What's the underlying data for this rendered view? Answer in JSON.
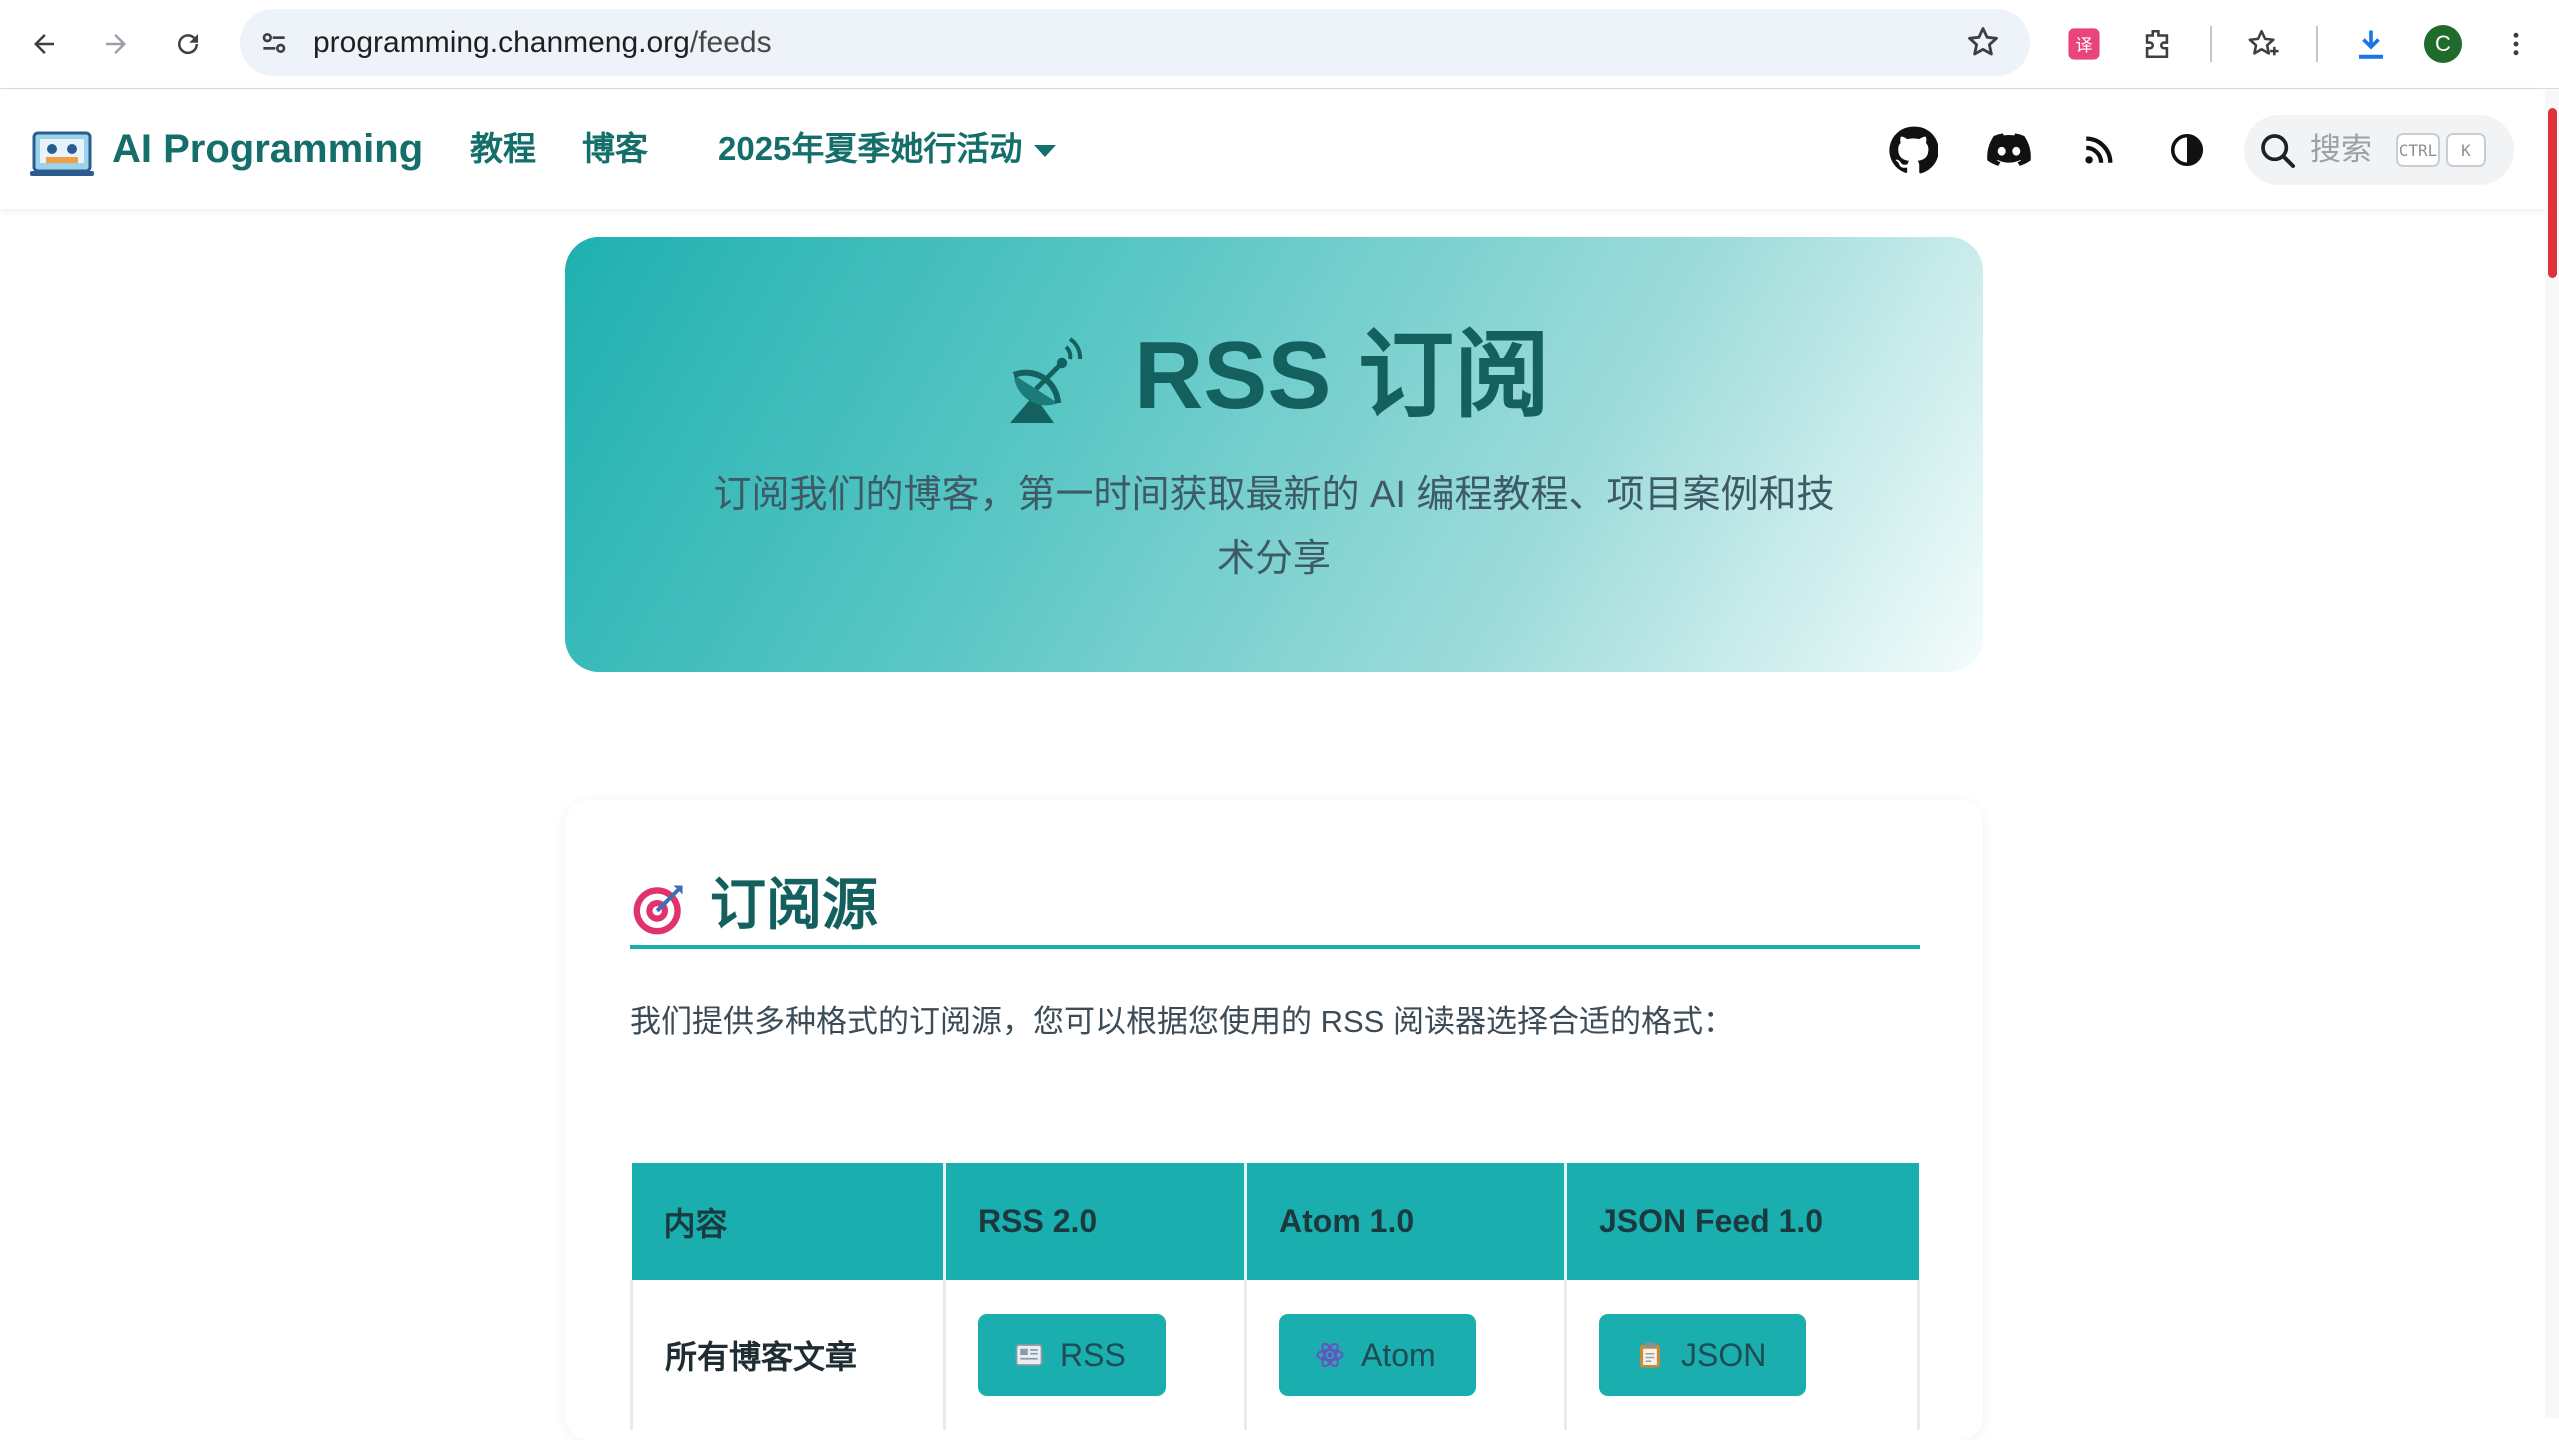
{
  "browser": {
    "url_host": "programming.chanmeng.org",
    "url_path": "/feeds",
    "profile_initial": "C"
  },
  "site": {
    "brand": "AI Programming",
    "nav": {
      "tutorials": "教程",
      "blog": "博客",
      "event": "2025年夏季她行活动"
    },
    "search_placeholder": "搜索",
    "search_kbd_ctrl": "CTRL",
    "search_kbd_k": "K"
  },
  "hero": {
    "title": "RSS 订阅",
    "subtitle_line1": "订阅我们的博客，第一时间获取最新的 AI 编程教程、项目案例和技",
    "subtitle_line2": "术分享"
  },
  "feeds_section": {
    "title": "订阅源",
    "description": "我们提供多种格式的订阅源，您可以根据您使用的 RSS 阅读器选择合适的格式：",
    "table": {
      "headers": [
        "内容",
        "RSS 2.0",
        "Atom 1.0",
        "JSON Feed 1.0"
      ],
      "rows": [
        {
          "content": "所有博客文章",
          "rss_label": "RSS",
          "atom_label": "Atom",
          "json_label": "JSON"
        }
      ]
    }
  },
  "colors": {
    "teal": "#1aafae",
    "brand_text": "#146e6a",
    "hero_title": "#13605e"
  }
}
